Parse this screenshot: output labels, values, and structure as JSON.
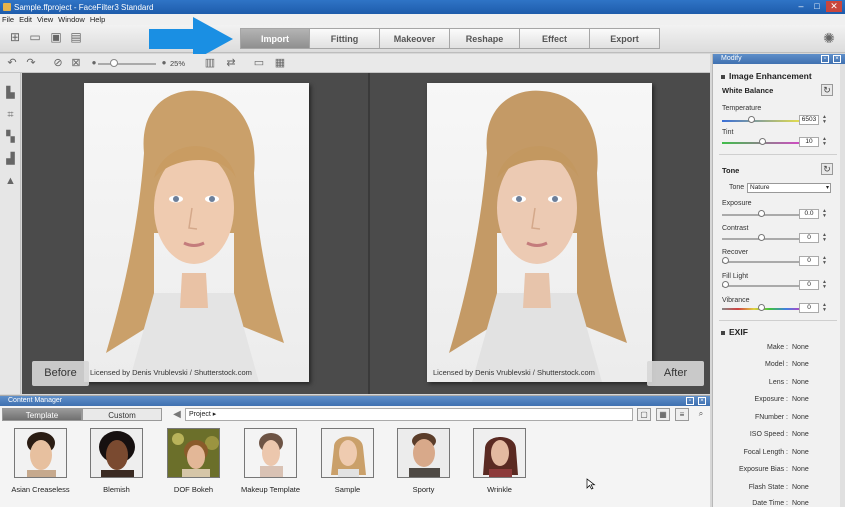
{
  "window": {
    "title": "Sample.ffproject - FaceFilter3 Standard"
  },
  "menu": [
    "File",
    "Edit",
    "View",
    "Window",
    "Help"
  ],
  "tabs": [
    "Import",
    "Fitting",
    "Makeover",
    "Reshape",
    "Effect",
    "Export"
  ],
  "active_tab": "Import",
  "zoom": {
    "value": "25%",
    "level": 0.25
  },
  "viewer": {
    "before_label": "Before",
    "after_label": "After",
    "credit": "Licensed by Denis Vrublevski  /  Shutterstock.com"
  },
  "content_manager": {
    "title": "Content Manager",
    "tabs": [
      "Template",
      "Custom"
    ],
    "path": "Project ▸",
    "thumbnails": [
      "Asian Creaseless",
      "Blemish",
      "DOF Bokeh",
      "Makeup Template",
      "Sample",
      "Sporty",
      "Wrinkle"
    ]
  },
  "modify": {
    "title": "Modify",
    "section": "Image Enhancement",
    "white_balance": {
      "title": "White Balance",
      "temperature": {
        "label": "Temperature",
        "value": "6503"
      },
      "tint": {
        "label": "Tint",
        "value": "10"
      }
    },
    "tone": {
      "title": "Tone",
      "select_label": "Tone",
      "select_value": "Nature",
      "sliders": [
        {
          "label": "Exposure",
          "value": "0.0"
        },
        {
          "label": "Contrast",
          "value": "0"
        },
        {
          "label": "Recover",
          "value": "0"
        },
        {
          "label": "Fill Light",
          "value": "0"
        },
        {
          "label": "Vibrance",
          "value": "0"
        }
      ]
    },
    "exif": {
      "title": "EXIF",
      "rows": [
        {
          "key": "Make :",
          "value": "None"
        },
        {
          "key": "Model :",
          "value": "None"
        },
        {
          "key": "Lens :",
          "value": "None"
        },
        {
          "key": "Exposure :",
          "value": "None"
        },
        {
          "key": "FNumber :",
          "value": "None"
        },
        {
          "key": "ISO Speed :",
          "value": "None"
        },
        {
          "key": "Focal Length :",
          "value": "None"
        },
        {
          "key": "Exposure Bias :",
          "value": "None"
        },
        {
          "key": "Flash State :",
          "value": "None"
        },
        {
          "key": "Date Time :",
          "value": "None"
        }
      ]
    }
  },
  "colors": {
    "accent_arrow": "#1a8fe3",
    "title_bar": "#2a6bbd",
    "active_tab": "#9e9e9e"
  }
}
